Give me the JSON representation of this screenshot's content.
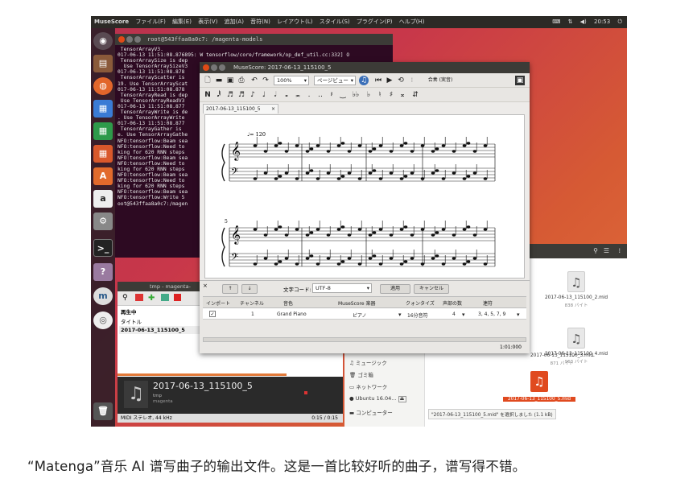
{
  "topbar": {
    "app": "MuseScore",
    "menus": [
      "ファイル(F)",
      "編集(E)",
      "表示(V)",
      "追加(A)",
      "音符(N)",
      "レイアウト(L)",
      "スタイル(S)",
      "プラグイン(P)",
      "ヘルプ(H)"
    ],
    "clock": "20:53"
  },
  "terminal": {
    "title": "root@543ffaa8a0c7: /magenta-models",
    "lines": [
      " TensorArrayV3.",
      "017-06-13 11:51:08.876895: W tensorflow/core/framework/op_def_util.cc:332] O",
      " TensorArraySize is dep",
      "  Use TensorArraySizeV3",
      "017-06-13 11:51:08.878",
      " TensorArrayScatter is",
      "19. Use TensorArrayScat",
      "017-06-13 11:51:08.878",
      " TensorArrayRead is dep",
      " Use TensorArrayReadV3",
      "017-06-13 11:51:08.877",
      " TensorArrayWrite is de",
      ". Use TensorArrayWrite",
      "017-06-13 11:51:08.877",
      " TensorArrayGather is",
      "e. Use TensorArrayGathe",
      "NFO:tensorflow:Beam sea",
      "NFO:tensorflow:Need to",
      "king for 620 RNN steps",
      "NFO:tensorflow:Beam sea",
      "NFO:tensorflow:Need to",
      "king for 620 RNN steps",
      "NFO:tensorflow:Beam sea",
      "NFO:tensorflow:Need to",
      "king for 620 RNN steps",
      "NFO:tensorflow:Beam sea",
      "NFO:tensorflow:Write 5",
      "oot@543ffaa8a0c7:/magen"
    ]
  },
  "musescore": {
    "title": "MuseScore: 2017-06-13_115100_5",
    "zoom": "100%",
    "view_mode": "ページビュー",
    "score_tab": "2017-06-13_115100_5",
    "tempo": "♩= 120",
    "measure_number": "5",
    "midi_panel": {
      "encoding_label": "文字コード:",
      "encoding_value": "UTF-8",
      "apply_button": "適用",
      "cancel_button": "キャンセル",
      "columns": [
        "インポート",
        "チャンネル",
        "音色",
        "MuseScore 楽器",
        "クォンタイズ",
        "声部の数",
        "連符"
      ],
      "row": {
        "channel": "1",
        "sound": "Grand Piano",
        "instrument": "ピアノ",
        "quantize": "16分音符",
        "voices": "4",
        "tuplets": "3, 4, 5, 7, 9"
      },
      "duration": "1:01:000"
    }
  },
  "rhythmbox": {
    "title": "tmp - magenta-",
    "col_playing": "再生中",
    "col_title": "タイトル",
    "track": "2017-06-13_115100_5",
    "now_playing": "2017-06-13_115100_5",
    "artist": "tmp",
    "album": "magenta",
    "format": "MIDI ステレオ, 44 kHz",
    "time": "0:15 / 0:15"
  },
  "files": {
    "sidebar": [
      "ミュージック",
      "ゴミ箱",
      "ネットワーク",
      "Ubuntu 16.04...",
      "コンピューター"
    ],
    "items": [
      {
        "name": "2017-06-13_115100_2.mid",
        "size": "838 バイト"
      },
      {
        "name": "2017-06-13_115100_3.mid",
        "size": "871 バイト"
      },
      {
        "name": "2017-06-13_115100_4.mid",
        "size": "963 バイト"
      },
      {
        "name": "2017-06-13_115100_5.mid",
        "size": ""
      }
    ],
    "status": "\"2017-06-13_115100_5.mid\" を選択しました (1.1 kB)"
  },
  "caption": "“Matenga”音乐 AI 谱写曲子的输出文件。这是一首比较好听的曲子，谱写得不错。"
}
